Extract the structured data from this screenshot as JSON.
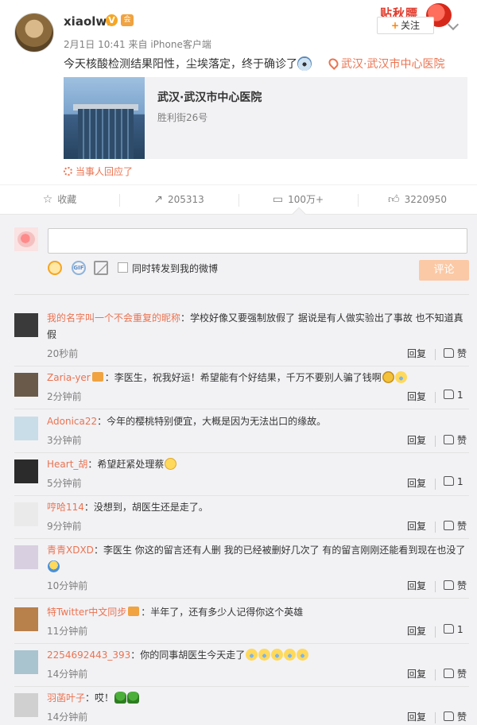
{
  "post": {
    "username": "xiaolwl",
    "verified_badge": "V",
    "vip_badge": "会",
    "date": "2月1日 10:41",
    "source": "来自 iPhone客户端",
    "text": "今天核酸检测结果阳性，尘埃落定，终于确诊了",
    "location_link": "武汉·武汉市中心医院",
    "location_card": {
      "name": "武汉·武汉市中心医院",
      "address": "胜利街26号"
    },
    "responded_label": "当事人回应了",
    "stamp_text": "贴秋膘",
    "follow_label": "关注",
    "follow_plus": "+"
  },
  "action_bar": {
    "favorite_label": "收藏",
    "repost_count": "205313",
    "comment_count": "100万+",
    "like_count": "3220950"
  },
  "composer": {
    "sync_label": "同时转发到我的微博",
    "submit_label": "评论",
    "gif_label": "GIF"
  },
  "comments": [
    {
      "name": "我的名字叫一个不会重复的昵称",
      "text": "：学校好像又要强制放假了 据说是有人做实验出了事故 也不知道真假",
      "time": "20秒前",
      "likes": ""
    },
    {
      "name": "Zaria-yer",
      "text": "：李医生，祝我好运！希望能有个好结果，千万不要别人骗了钱啊",
      "time": "2分钟前",
      "likes": "1"
    },
    {
      "name": "Adonica22",
      "text": "：今年的樱桃特别便宜，大概是因为无法出口的缘故。",
      "time": "3分钟前",
      "likes": ""
    },
    {
      "name": "Heart_胡",
      "text": "：希望赶紧处理蔡",
      "time": "5分钟前",
      "likes": "1"
    },
    {
      "name": "哼哈114",
      "text": "：没想到，胡医生还是走了。",
      "time": "9分钟前",
      "likes": ""
    },
    {
      "name": "青青XDXD",
      "text": "：李医生 你这的留言还有人删 我的已经被删好几次了 有的留言刚刚还能看到现在也没了",
      "time": "10分钟前",
      "likes": ""
    },
    {
      "name": "特Twitter中文同步",
      "text": "：半年了，还有多少人记得你这个英雄",
      "time": "11分钟前",
      "likes": "1"
    },
    {
      "name": "2254692443_393",
      "text": "：你的同事胡医生今天走了",
      "time": "14分钟前",
      "likes": ""
    },
    {
      "name": "羽菡叶子",
      "text": "：哎！",
      "time": "14分钟前",
      "likes": ""
    }
  ],
  "labels": {
    "reply": "回复",
    "like": "赞"
  },
  "colors": {
    "accent": "#eb7350",
    "orange": "#ff8200",
    "submit_disabled": "#fbc9a6",
    "background": "#f2f2f5"
  },
  "icons": [
    "star-icon",
    "repost-icon",
    "comment-icon",
    "thumb-up-icon",
    "location-pin-icon",
    "smile-icon",
    "gif-icon",
    "image-icon",
    "chevron-down-icon"
  ]
}
